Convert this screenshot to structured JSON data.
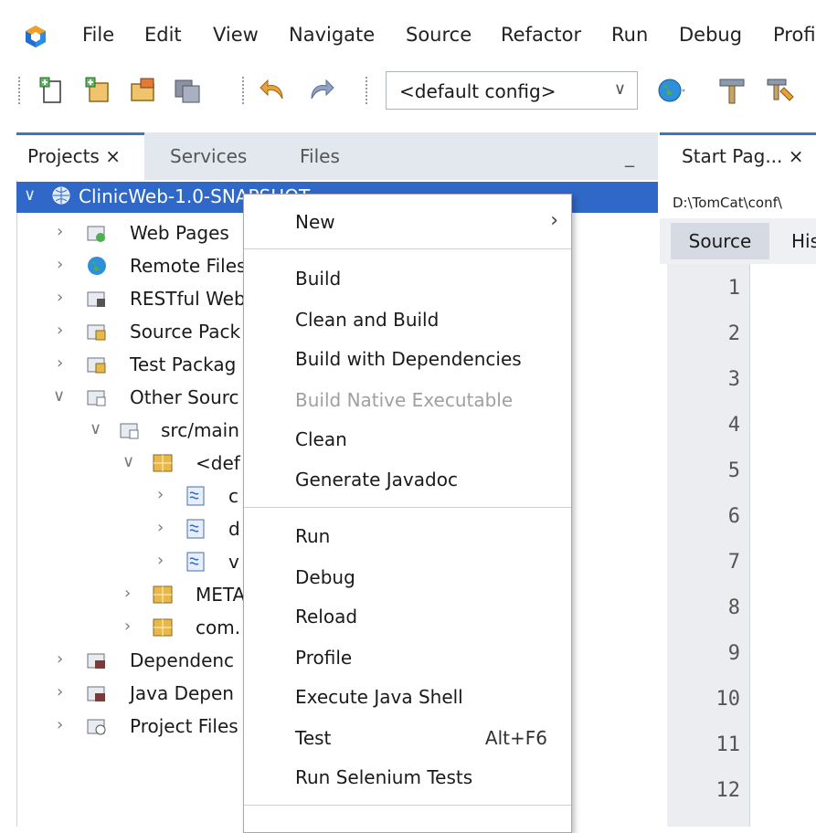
{
  "menubar": {
    "items": [
      "File",
      "Edit",
      "View",
      "Navigate",
      "Source",
      "Refactor",
      "Run",
      "Debug",
      "Profi"
    ]
  },
  "toolbar": {
    "config_value": "<default config>",
    "icons": [
      "new-file-icon",
      "new-project-icon",
      "open-project-icon",
      "save-all-icon",
      "undo-icon",
      "redo-icon",
      "browser-globe-icon",
      "build-hammer-icon",
      "clean-build-icon"
    ]
  },
  "projects_panel": {
    "tabs": [
      "Projects ×",
      "Services",
      "Files"
    ],
    "minimize": "_",
    "tree": [
      {
        "label": "ClinicWeb-1.0-SNAPSHOT",
        "icon": "web-project-icon",
        "expanded": true,
        "level": 0
      },
      {
        "label": "Web Pages",
        "icon": "web-pages-folder-icon",
        "level": 1
      },
      {
        "label": "Remote Files",
        "icon": "remote-globe-icon",
        "level": 1
      },
      {
        "label": "RESTful Web",
        "icon": "rest-folder-icon",
        "level": 1
      },
      {
        "label": "Source Pack",
        "icon": "package-folder-icon",
        "level": 1
      },
      {
        "label": "Test Packag",
        "icon": "package-folder-icon",
        "level": 1
      },
      {
        "label": "Other Sourc",
        "icon": "folder-icon",
        "expanded": true,
        "level": 1
      },
      {
        "label": "src/main",
        "icon": "folder-icon",
        "expanded": true,
        "level": 2
      },
      {
        "label": "<def",
        "icon": "package-icon",
        "expanded": true,
        "level": 3
      },
      {
        "label": "c",
        "icon": "properties-file-icon",
        "level": 4
      },
      {
        "label": "d",
        "icon": "properties-file-icon",
        "level": 4
      },
      {
        "label": "v",
        "icon": "properties-file-icon",
        "level": 4
      },
      {
        "label": "META",
        "icon": "package-icon",
        "level": 3
      },
      {
        "label": "com.",
        "icon": "package-icon",
        "level": 3
      },
      {
        "label": "Dependenc",
        "icon": "dependencies-folder-icon",
        "level": 1
      },
      {
        "label": "Java Depen",
        "icon": "dependencies-folder-icon",
        "level": 1
      },
      {
        "label": "Project Files",
        "icon": "project-files-folder-icon",
        "level": 1
      }
    ]
  },
  "editor": {
    "tab_label": "Start Pag... ×",
    "path": "D:\\TomCat\\conf\\",
    "source_tab": "Source",
    "history_tab": "His",
    "line_numbers": [
      "1",
      "2",
      "3",
      "4",
      "5",
      "6",
      "7",
      "8",
      "9",
      "10",
      "11",
      "12"
    ]
  },
  "context_menu": {
    "new_label": "New",
    "group1": [
      "Build",
      "Clean and Build",
      "Build with Dependencies",
      "Build Native Executable",
      "Clean",
      "Generate Javadoc"
    ],
    "group2": [
      "Run",
      "Debug",
      "Reload",
      "Profile",
      "Execute Java Shell",
      "Test",
      "Run Selenium Tests"
    ],
    "test_shortcut": "Alt+F6",
    "disabled": [
      "Build Native Executable"
    ]
  },
  "colors": {
    "selection": "#2f68c6",
    "panel_tab_bg": "#e3e7ee",
    "active_tab_border": "#3e74c5"
  }
}
